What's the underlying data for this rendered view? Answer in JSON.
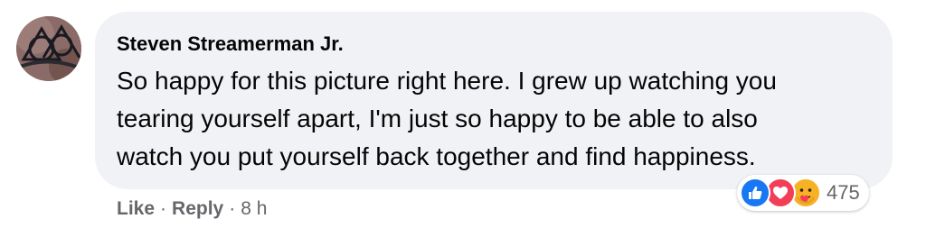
{
  "comment": {
    "author": "Steven Streamerman Jr.",
    "text_lines": [
      "So happy for this picture right here. I grew up watching you",
      "tearing yourself apart, I'm just so happy to be able to also",
      "watch you put yourself back together and find happiness."
    ],
    "actions": {
      "like_label": "Like",
      "reply_label": "Reply",
      "separator": "·",
      "timestamp": "8 h"
    },
    "reactions": {
      "icons": [
        "like-icon",
        "love-icon",
        "care-icon"
      ],
      "count": "475"
    }
  },
  "colors": {
    "bubble": "#f0f2f5",
    "secondary_text": "#65676b",
    "like_blue": "#1877f2",
    "love_red": "#f33e58",
    "care_yellow": "#f7b125"
  }
}
